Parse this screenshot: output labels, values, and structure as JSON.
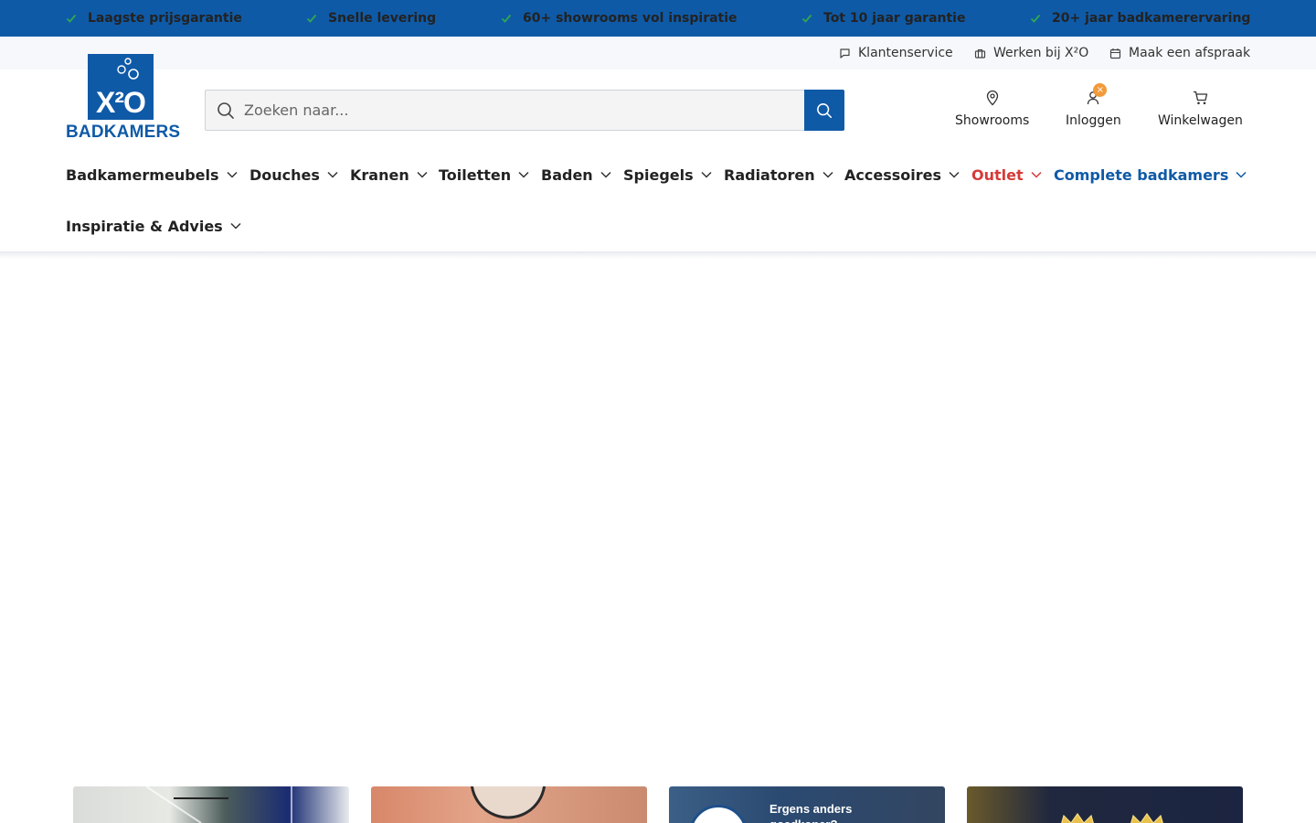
{
  "usp_bar": {
    "items": [
      "Laagste prijsgarantie",
      "Snelle levering",
      "60+ showrooms vol inspiratie",
      "Tot 10 jaar garantie",
      "20+ jaar badkamerervaring"
    ],
    "icon": "check-icon",
    "check_color": "#2fa84f",
    "background": "#0f5aa7"
  },
  "utility_links": {
    "customer_service": "Klantenservice",
    "careers": "Werken bij X²O",
    "appointment": "Maak een afspraak"
  },
  "logo": {
    "mark": "X²O",
    "text": "BADKAMERS"
  },
  "search": {
    "placeholder": "Zoeken naar...",
    "value": ""
  },
  "account": {
    "showrooms": "Showrooms",
    "login": "Inloggen",
    "login_badge": "×",
    "cart": "Winkelwagen"
  },
  "nav": {
    "items": [
      "Badkamermeubels",
      "Douches",
      "Kranen",
      "Toiletten",
      "Baden",
      "Spiegels",
      "Radiatoren",
      "Accessoires",
      "Outlet",
      "Complete badkamers",
      "Inspiratie & Advies"
    ],
    "outlet_color": "#d63a37",
    "highlight_color": "#0f5aa7"
  },
  "cards": {
    "card3_title": "Ergens anders goedkoper?"
  },
  "colors": {
    "brand_blue": "#0f5aa7",
    "badge_orange": "#f29a3b"
  }
}
